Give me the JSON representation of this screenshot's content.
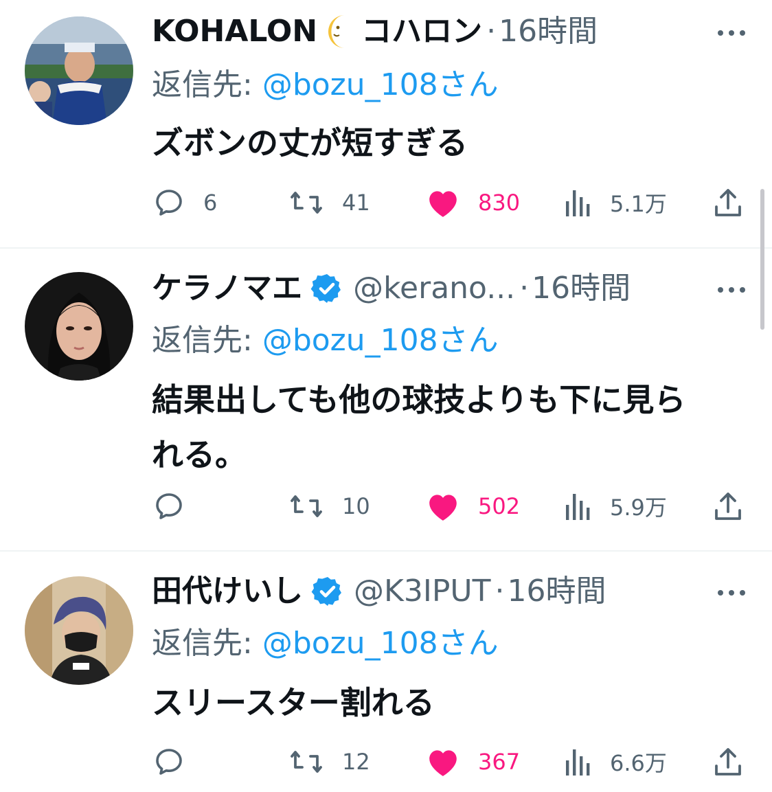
{
  "colors": {
    "link": "#1d9bf0",
    "muted": "#536471",
    "like": "#f91880",
    "verified": "#1d9bf0",
    "divider": "#eff3f4"
  },
  "tweets": [
    {
      "name": "KOHALON",
      "name_emoji_icon": "crescent-moon-icon",
      "name_suffix": "コハロン",
      "handle": "",
      "verified": false,
      "separator": "·",
      "time": "16時間",
      "reply_prefix": "返信先: ",
      "reply_to": "@bozu_108さん",
      "text_lines": [
        "ズボンの丈が短すぎる"
      ],
      "replies": "6",
      "retweets": "41",
      "likes": "830",
      "views": "5.1万",
      "liked": true
    },
    {
      "name": "ケラノマエ",
      "handle": "@kerano...",
      "verified": true,
      "separator": "·",
      "time": "16時間",
      "reply_prefix": "返信先: ",
      "reply_to": "@bozu_108さん",
      "text_lines": [
        "結果出しても他の球技よりも下に見ら",
        "れる。"
      ],
      "replies": "",
      "retweets": "10",
      "likes": "502",
      "views": "5.9万",
      "liked": true
    },
    {
      "name": "田代けいし",
      "handle": "@K3IPUT",
      "verified": true,
      "separator": "·",
      "time": "16時間",
      "reply_prefix": "返信先: ",
      "reply_to": "@bozu_108さん",
      "text_lines": [
        "スリースター割れる"
      ],
      "replies": "",
      "retweets": "12",
      "likes": "367",
      "views": "6.6万",
      "liked": true
    }
  ]
}
